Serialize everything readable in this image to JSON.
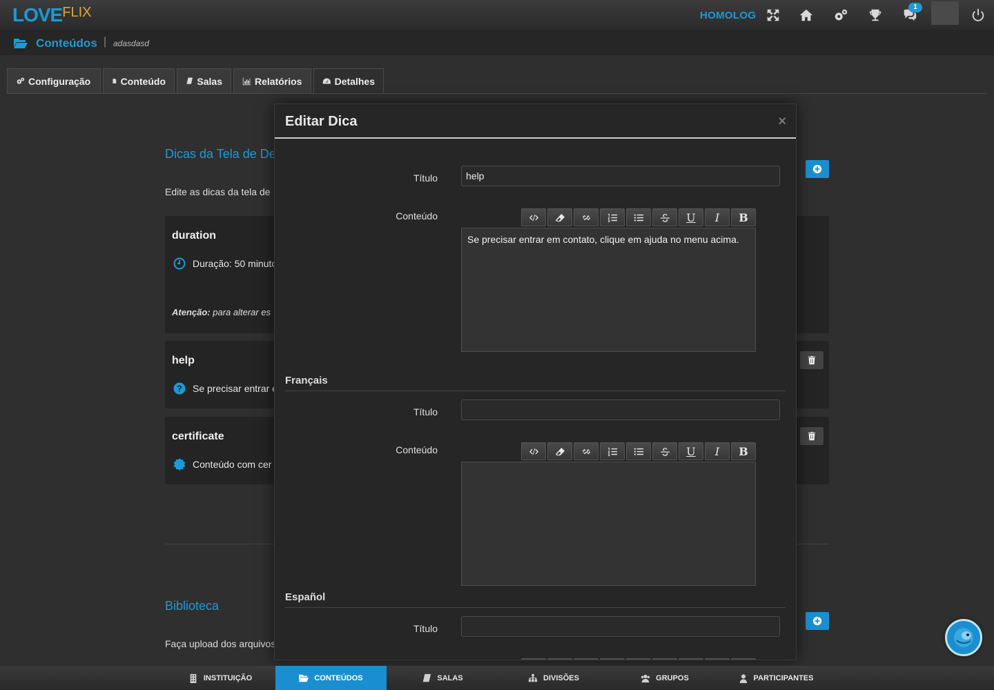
{
  "brand": {
    "love": "LOVE",
    "flix": "FLIX"
  },
  "topbar": {
    "env_label": "HOMOLOG",
    "notifications_count": "1"
  },
  "breadcrumb": {
    "title": "Conteúdos",
    "separator": "|",
    "subtitle": "adasdasd"
  },
  "tabs": [
    {
      "label": "Configuração",
      "icon": "gears-icon"
    },
    {
      "label": "Conteúdo",
      "icon": "file-icon"
    },
    {
      "label": "Salas",
      "icon": "book-icon"
    },
    {
      "label": "Relatórios",
      "icon": "bar-chart-icon"
    },
    {
      "label": "Detalhes",
      "icon": "dashboard-icon"
    }
  ],
  "tips_section": {
    "title": "Dicas da Tela de De",
    "description": "Edite as dicas da tela de",
    "cards": [
      {
        "title": "duration",
        "text": "Duração: 50 minuto",
        "note_bold": "Atenção:",
        "note": " para alterar es"
      },
      {
        "title": "help",
        "text": "Se precisar entrar e"
      },
      {
        "title": "certificate",
        "text": "Conteúdo com cer"
      }
    ]
  },
  "library_section": {
    "title": "Biblioteca",
    "description": "Faça upload dos arquivos"
  },
  "modal": {
    "title": "Editar Dica",
    "close": "×",
    "label_title": "Título",
    "label_content": "Conteúdo",
    "default_title_value": "help",
    "default_content": "Se precisar entrar em contato, clique em ajuda no menu acima.",
    "lang_fr": "Français",
    "lang_es": "Español",
    "fr_title_value": "",
    "es_title_value": "",
    "toolbar": {
      "underline": "U",
      "italic": "I",
      "bold": "B"
    }
  },
  "bottom_nav": [
    {
      "label": "INSTITUIÇÃO",
      "icon": "building-icon"
    },
    {
      "label": "CONTEÚDOS",
      "icon": "folder-open-icon",
      "active": true
    },
    {
      "label": "SALAS",
      "icon": "book-icon"
    },
    {
      "label": "DIVISÕES",
      "icon": "sitemap-icon"
    },
    {
      "label": "GRUPOS",
      "icon": "group-icon"
    },
    {
      "label": "PARTICIPANTES",
      "icon": "user-icon"
    }
  ],
  "colors": {
    "accent": "#1a9bd8",
    "brand_flix": "#e0a63b",
    "background": "#2f2f2f",
    "modal_bg": "#262626"
  }
}
